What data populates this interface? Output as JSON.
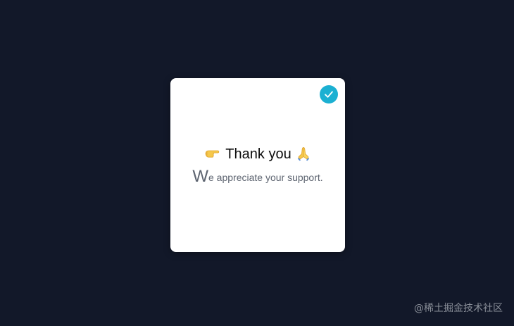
{
  "card": {
    "badge_icon": "check-icon",
    "heading": {
      "left_emoji": "👉",
      "left_icon": "pointing-right-hand-icon",
      "text": "Thank you",
      "right_emoji": "🙏",
      "right_icon": "praying-hands-icon"
    },
    "message": {
      "drop_cap": "W",
      "rest": "e appreciate your support."
    }
  },
  "watermark": "@稀土掘金技术社区",
  "colors": {
    "background": "#121829",
    "card": "#ffffff",
    "badge": "#1cb0d2",
    "heading_text": "#0c0c0c",
    "message_text": "#5d6470"
  }
}
